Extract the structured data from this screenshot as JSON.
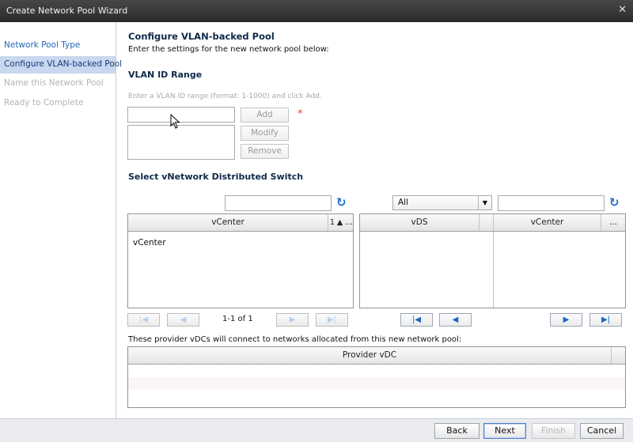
{
  "window": {
    "title": "Create Network Pool Wizard",
    "close_label": "✕"
  },
  "sidebar": {
    "steps": [
      {
        "label": "Network Pool Type",
        "state": "link"
      },
      {
        "label": "Configure VLAN-backed Pool",
        "state": "active"
      },
      {
        "label": "Name this Network Pool",
        "state": "disabled"
      },
      {
        "label": "Ready to Complete",
        "state": "disabled"
      }
    ]
  },
  "main": {
    "title": "Configure VLAN-backed Pool",
    "subtitle": "Enter the settings for the new network pool below:",
    "vlan": {
      "heading": "VLAN ID Range",
      "hint": "Enter a VLAN ID range (format: 1-1000) and click Add.",
      "input_value": "",
      "required_mark": "*",
      "add_label": "Add",
      "modify_label": "Modify",
      "remove_label": "Remove"
    },
    "vds": {
      "heading": "Select vNetwork Distributed Switch",
      "left_search_value": "",
      "filter_selected": "All",
      "right_search_value": "",
      "left_grid": {
        "column": "vCenter",
        "sort_label": "1 ▲",
        "more_label": "...",
        "rows": [
          "vCenter"
        ],
        "pager_text": "1-1 of 1"
      },
      "right_grid": {
        "columns": [
          "vDS",
          "vCenter"
        ],
        "more_label": "...",
        "rows": []
      }
    },
    "provider": {
      "note": "These provider vDCs will connect to networks allocated from this new network pool:",
      "column": "Provider vDC",
      "rows": []
    }
  },
  "footer": {
    "back_label": "Back",
    "next_label": "Next",
    "finish_label": "Finish",
    "cancel_label": "Cancel"
  },
  "colors": {
    "accent": "#1e6fd0",
    "active_step_bg": "#c9d7ef",
    "required": "#e0443b"
  }
}
